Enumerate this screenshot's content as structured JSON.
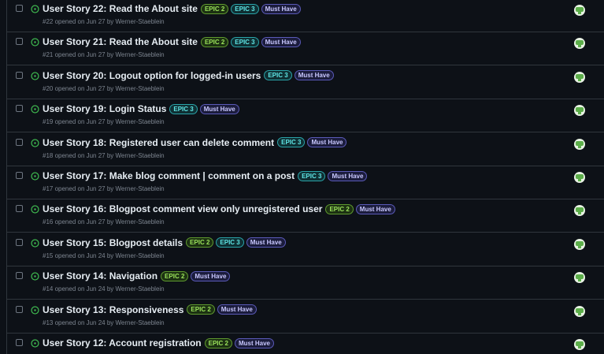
{
  "issues": [
    {
      "title": "User Story 22: Read the About site",
      "labels": [
        {
          "text": "EPIC 2",
          "kind": "epic2"
        },
        {
          "text": "EPIC 3",
          "kind": "epic3"
        },
        {
          "text": "Must Have",
          "kind": "must"
        }
      ],
      "meta": "#22 opened on Jun 27 by Werner-Staeblein"
    },
    {
      "title": "User Story 21: Read the About site",
      "labels": [
        {
          "text": "EPIC 2",
          "kind": "epic2"
        },
        {
          "text": "EPIC 3",
          "kind": "epic3"
        },
        {
          "text": "Must Have",
          "kind": "must"
        }
      ],
      "meta": "#21 opened on Jun 27 by Werner-Staeblein"
    },
    {
      "title": "User Story 20: Logout option for logged-in users",
      "labels": [
        {
          "text": "EPIC 3",
          "kind": "epic3"
        },
        {
          "text": "Must Have",
          "kind": "must"
        }
      ],
      "meta": "#20 opened on Jun 27 by Werner-Staeblein"
    },
    {
      "title": "User Story 19: Login Status",
      "labels": [
        {
          "text": "EPIC 3",
          "kind": "epic3"
        },
        {
          "text": "Must Have",
          "kind": "must"
        }
      ],
      "meta": "#19 opened on Jun 27 by Werner-Staeblein"
    },
    {
      "title": "User Story 18: Registered user can delete comment",
      "labels": [
        {
          "text": "EPIC 3",
          "kind": "epic3"
        },
        {
          "text": "Must Have",
          "kind": "must"
        }
      ],
      "meta": "#18 opened on Jun 27 by Werner-Staeblein"
    },
    {
      "title": "User Story 17: Make blog comment | comment on a post",
      "labels": [
        {
          "text": "EPIC 3",
          "kind": "epic3"
        },
        {
          "text": "Must Have",
          "kind": "must"
        }
      ],
      "meta": "#17 opened on Jun 27 by Werner-Staeblein"
    },
    {
      "title": "User Story 16: Blogpost comment view only unregistered user",
      "labels": [
        {
          "text": "EPIC 2",
          "kind": "epic2"
        },
        {
          "text": "Must Have",
          "kind": "must"
        }
      ],
      "meta": "#16 opened on Jun 27 by Werner-Staeblein"
    },
    {
      "title": "User Story 15: Blogpost details",
      "labels": [
        {
          "text": "EPIC 2",
          "kind": "epic2"
        },
        {
          "text": "EPIC 3",
          "kind": "epic3"
        },
        {
          "text": "Must Have",
          "kind": "must"
        }
      ],
      "meta": "#15 opened on Jun 24 by Werner-Staeblein"
    },
    {
      "title": "User Story 14: Navigation",
      "labels": [
        {
          "text": "EPIC 2",
          "kind": "epic2"
        },
        {
          "text": "Must Have",
          "kind": "must"
        }
      ],
      "meta": "#14 opened on Jun 24 by Werner-Staeblein"
    },
    {
      "title": "User Story 13: Responsiveness",
      "labels": [
        {
          "text": "EPIC 2",
          "kind": "epic2"
        },
        {
          "text": "Must Have",
          "kind": "must"
        }
      ],
      "meta": "#13 opened on Jun 24 by Werner-Staeblein"
    },
    {
      "title": "User Story 12: Account registration",
      "labels": [
        {
          "text": "EPIC 2",
          "kind": "epic2"
        },
        {
          "text": "Must Have",
          "kind": "must"
        }
      ],
      "meta": ""
    }
  ],
  "colors": {
    "background": "#0d1117",
    "border": "#30363d",
    "open_icon": "#3fb950",
    "epic2": "#9be35b",
    "epic3": "#5fe6e6",
    "must_have": "#c9c8ff"
  },
  "icons": {
    "status": "issue-opened-icon",
    "assignee": "identicon-avatar"
  }
}
